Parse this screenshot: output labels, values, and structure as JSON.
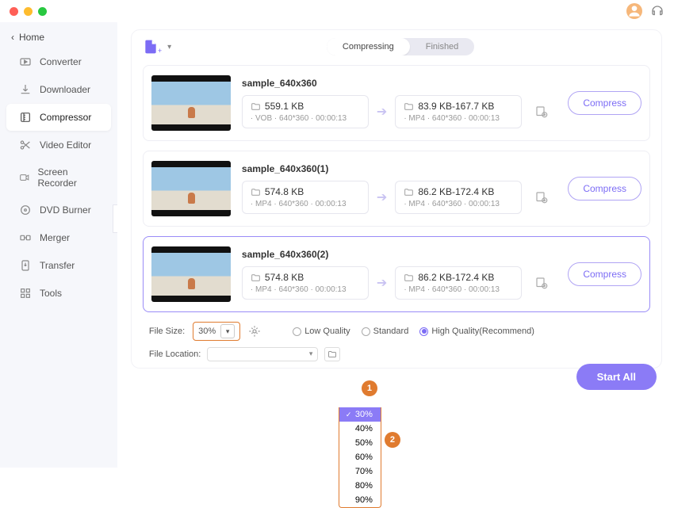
{
  "titlebar": {
    "home": "Home"
  },
  "sidebar": {
    "items": [
      {
        "label": "Converter"
      },
      {
        "label": "Downloader"
      },
      {
        "label": "Compressor"
      },
      {
        "label": "Video Editor"
      },
      {
        "label": "Screen Recorder"
      },
      {
        "label": "DVD Burner"
      },
      {
        "label": "Merger"
      },
      {
        "label": "Transfer"
      },
      {
        "label": "Tools"
      }
    ]
  },
  "tabs": {
    "compressing": "Compressing",
    "finished": "Finished"
  },
  "files": [
    {
      "name": "sample_640x360",
      "in": {
        "size": "559.1 KB",
        "meta": "· VOB  · 640*360  · 00:00:13"
      },
      "out": {
        "size": "83.9 KB-167.7 KB",
        "meta": "· MP4  · 640*360  · 00:00:13"
      }
    },
    {
      "name": "sample_640x360(1)",
      "in": {
        "size": "574.8 KB",
        "meta": "· MP4  · 640*360  · 00:00:13"
      },
      "out": {
        "size": "86.2 KB-172.4 KB",
        "meta": "· MP4  · 640*360  · 00:00:13"
      }
    },
    {
      "name": "sample_640x360(2)",
      "in": {
        "size": "574.8 KB",
        "meta": "· MP4  · 640*360  · 00:00:13"
      },
      "out": {
        "size": "86.2 KB-172.4 KB",
        "meta": "· MP4  · 640*360  · 00:00:13"
      }
    }
  ],
  "compress_btn": "Compress",
  "footer": {
    "filesize_label": "File Size:",
    "filesize_value": "30%",
    "quality": {
      "low": "Low Quality",
      "std": "Standard",
      "high": "High Quality(Recommend)"
    },
    "location_label": "File Location:"
  },
  "start_all": "Start  All",
  "dropdown": {
    "options": [
      "30%",
      "40%",
      "50%",
      "60%",
      "70%",
      "80%",
      "90%"
    ]
  },
  "annotations": {
    "a1": "1",
    "a2": "2"
  }
}
